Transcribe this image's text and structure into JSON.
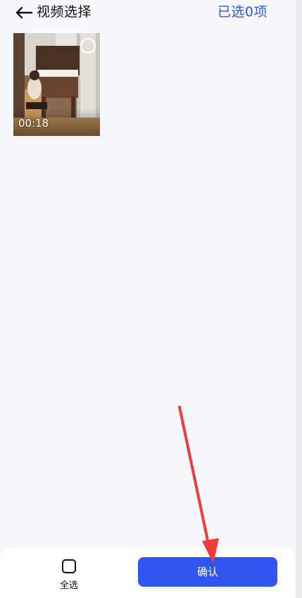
{
  "header": {
    "title": "视频选择",
    "selected_count": "已选0项",
    "accent_color": "#2f57e8",
    "back_icon": "arrow-left-icon"
  },
  "media": {
    "items": [
      {
        "duration": "00:18",
        "selected": false,
        "select_icon": "circle-checkbox-icon"
      }
    ]
  },
  "footer": {
    "select_all_label": "全选",
    "select_all_icon": "checkbox-icon",
    "confirm_label": "确认",
    "confirm_color": "#3155f0"
  },
  "annotation": {
    "arrow_color": "#ee3b3b"
  }
}
